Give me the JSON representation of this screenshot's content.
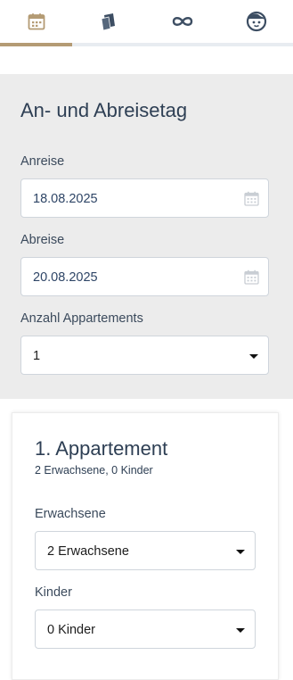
{
  "tabs": [
    {
      "icon": "calendar-icon",
      "active": true
    },
    {
      "icon": "cards-icon",
      "active": false
    },
    {
      "icon": "infinity-icon",
      "active": false
    },
    {
      "icon": "face-icon",
      "active": false
    }
  ],
  "dates_section": {
    "title": "An- und Abreisetag",
    "arrival": {
      "label": "Anreise",
      "value": "18.08.2025"
    },
    "departure": {
      "label": "Abreise",
      "value": "20.08.2025"
    },
    "apartments": {
      "label": "Anzahl Appartements",
      "value": "1"
    }
  },
  "apartment_card": {
    "title": "1. Appartement",
    "subtitle": "2 Erwachsene, 0 Kinder",
    "adults": {
      "label": "Erwachsene",
      "value": "2 Erwachsene"
    },
    "children": {
      "label": "Kinder",
      "value": "0 Kinder"
    }
  },
  "colors": {
    "accent": "#b49b74",
    "section_bg": "#ececec",
    "text": "#2e3f54"
  }
}
